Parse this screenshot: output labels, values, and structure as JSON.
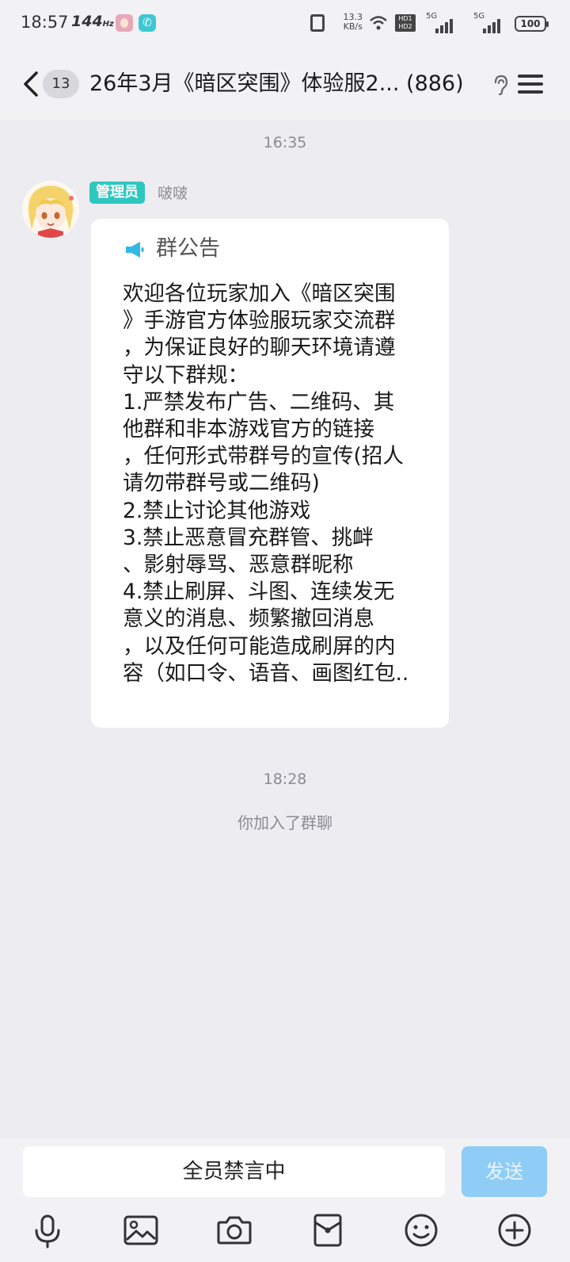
{
  "status_bar": {
    "time": "18:57",
    "refresh_rate": "144",
    "refresh_unit": "Hz",
    "net_speed_value": "13.3",
    "net_speed_unit": "KB/s",
    "hd_label_1": "HD1",
    "hd_label_2": "HD2",
    "signal_1_label": "5G",
    "signal_2_label": "5G",
    "battery": "100"
  },
  "header": {
    "unread_count": "13",
    "title": "26年3月《暗区突围》体验服2... (886)"
  },
  "messages": {
    "timestamp_1": "16:35",
    "sender_role": "管理员",
    "sender_name": "啵啵",
    "notice_title": "群公告",
    "notice_lines": [
      "欢迎各位玩家加入《暗区突围",
      "》手游官方体验服玩家交流群",
      "，为保证良好的聊天环境请遵",
      "守以下群规：",
      "1.严禁发布广告、二维码、其",
      "他群和非本游戏官方的链接",
      "，任何形式带群号的宣传(招人",
      "请勿带群号或二维码)",
      "2.禁止讨论其他游戏",
      "3.禁止恶意冒充群管、挑衅",
      "、影射辱骂、恶意群昵称",
      "4.禁止刷屏、斗图、连续发无",
      "意义的消息、频繁撤回消息",
      "，以及任何可能造成刷屏的内",
      "容（如口令、语音、画图红包.."
    ],
    "timestamp_2": "18:28",
    "system_message": "你加入了群聊"
  },
  "input": {
    "muted_text": "全员禁言中",
    "send_label": "发送"
  },
  "toolbar": {
    "icons": [
      "microphone-icon",
      "image-icon",
      "camera-icon",
      "red-packet-icon",
      "emoji-icon",
      "plus-icon"
    ]
  },
  "colors": {
    "background": "#ececf1",
    "admin_badge": "#2ec7c0",
    "send_button": "#8fcdf6",
    "megaphone": "#32b8e6"
  }
}
